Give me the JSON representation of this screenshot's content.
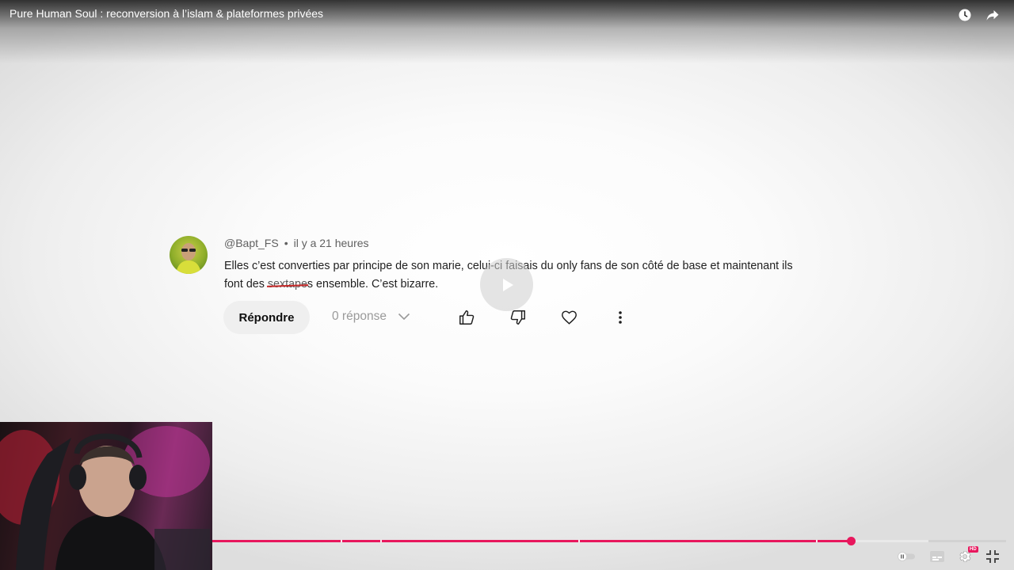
{
  "video": {
    "title": "Pure Human Soul : reconversion à l’islam & plateformes privées"
  },
  "top_actions": [
    {
      "name": "watch-later-icon"
    },
    {
      "name": "share-icon"
    }
  ],
  "comment": {
    "author": "@Bapt_FS",
    "separator": "•",
    "time": "il y a 21 heures",
    "text_line1": "Elles c’est converties par principe de son marie, celui-ci faisais du only fans de son côté de base et maintenant ils",
    "text_pre": "font des ",
    "text_struck": "sextape",
    "text_post": "s ensemble. C’est bizarre.",
    "reply_label": "Répondre",
    "replies_label": "0 réponse"
  },
  "player": {
    "progress": 0.804,
    "buffered": 0.902,
    "chapters": [
      0.162,
      0.212,
      0.461,
      0.76
    ],
    "progress_color": "#e8175d",
    "quality_badge": "HD",
    "controls": [
      "autoplay-toggle-icon",
      "subtitles-icon",
      "settings-gear-icon",
      "exit-fullscreen-icon"
    ]
  }
}
